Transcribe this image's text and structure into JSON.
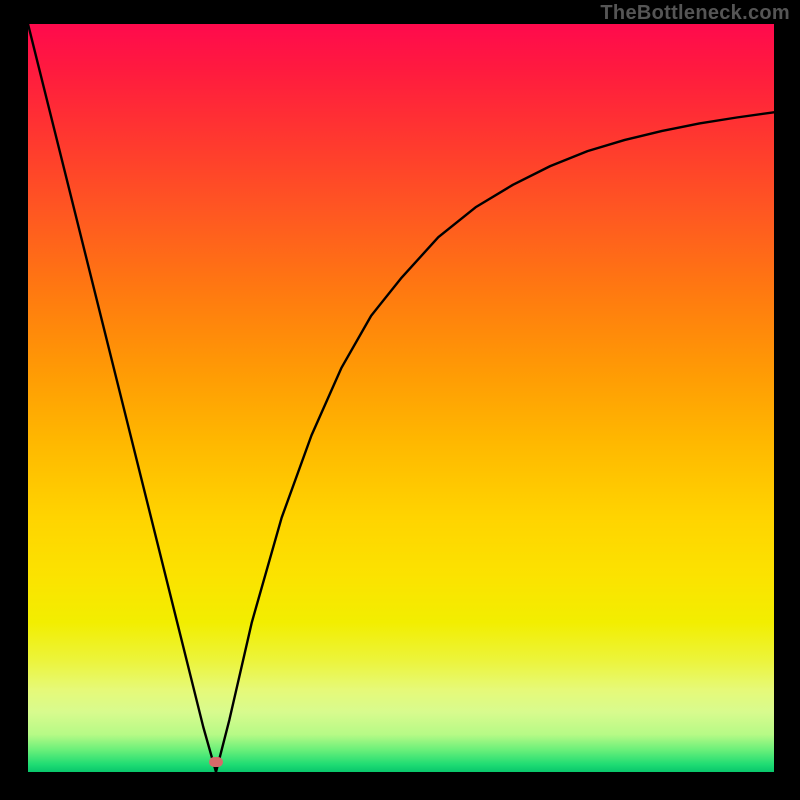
{
  "watermark": "TheBottleneck.com",
  "marker": {
    "x_frac": 0.252,
    "y_frac": 0.986,
    "color": "#d66a6a"
  },
  "chart_data": {
    "type": "line",
    "title": "",
    "xlabel": "",
    "ylabel": "",
    "xlim": [
      0,
      1
    ],
    "ylim": [
      0,
      1
    ],
    "note": "Axes are unlabeled; x and y are normalized to the plot box. Higher y in this data = higher on screen (closer to top).",
    "series": [
      {
        "name": "curve",
        "x": [
          0.0,
          0.05,
          0.1,
          0.15,
          0.2,
          0.235,
          0.252,
          0.27,
          0.3,
          0.34,
          0.38,
          0.42,
          0.46,
          0.5,
          0.55,
          0.6,
          0.65,
          0.7,
          0.75,
          0.8,
          0.85,
          0.9,
          0.95,
          1.0
        ],
        "y": [
          1.0,
          0.8,
          0.6,
          0.4,
          0.2,
          0.06,
          0.0,
          0.07,
          0.2,
          0.34,
          0.45,
          0.54,
          0.61,
          0.66,
          0.715,
          0.755,
          0.785,
          0.81,
          0.83,
          0.845,
          0.857,
          0.867,
          0.875,
          0.882
        ]
      }
    ],
    "marker_point": {
      "x": 0.252,
      "y": 0.0
    },
    "background_gradient": {
      "direction": "top-to-bottom",
      "stops": [
        {
          "pos": 0.0,
          "color": "#ff0a4d"
        },
        {
          "pos": 0.5,
          "color": "#ffb800"
        },
        {
          "pos": 0.8,
          "color": "#f2ee00"
        },
        {
          "pos": 1.0,
          "color": "#08c66c"
        }
      ]
    }
  }
}
